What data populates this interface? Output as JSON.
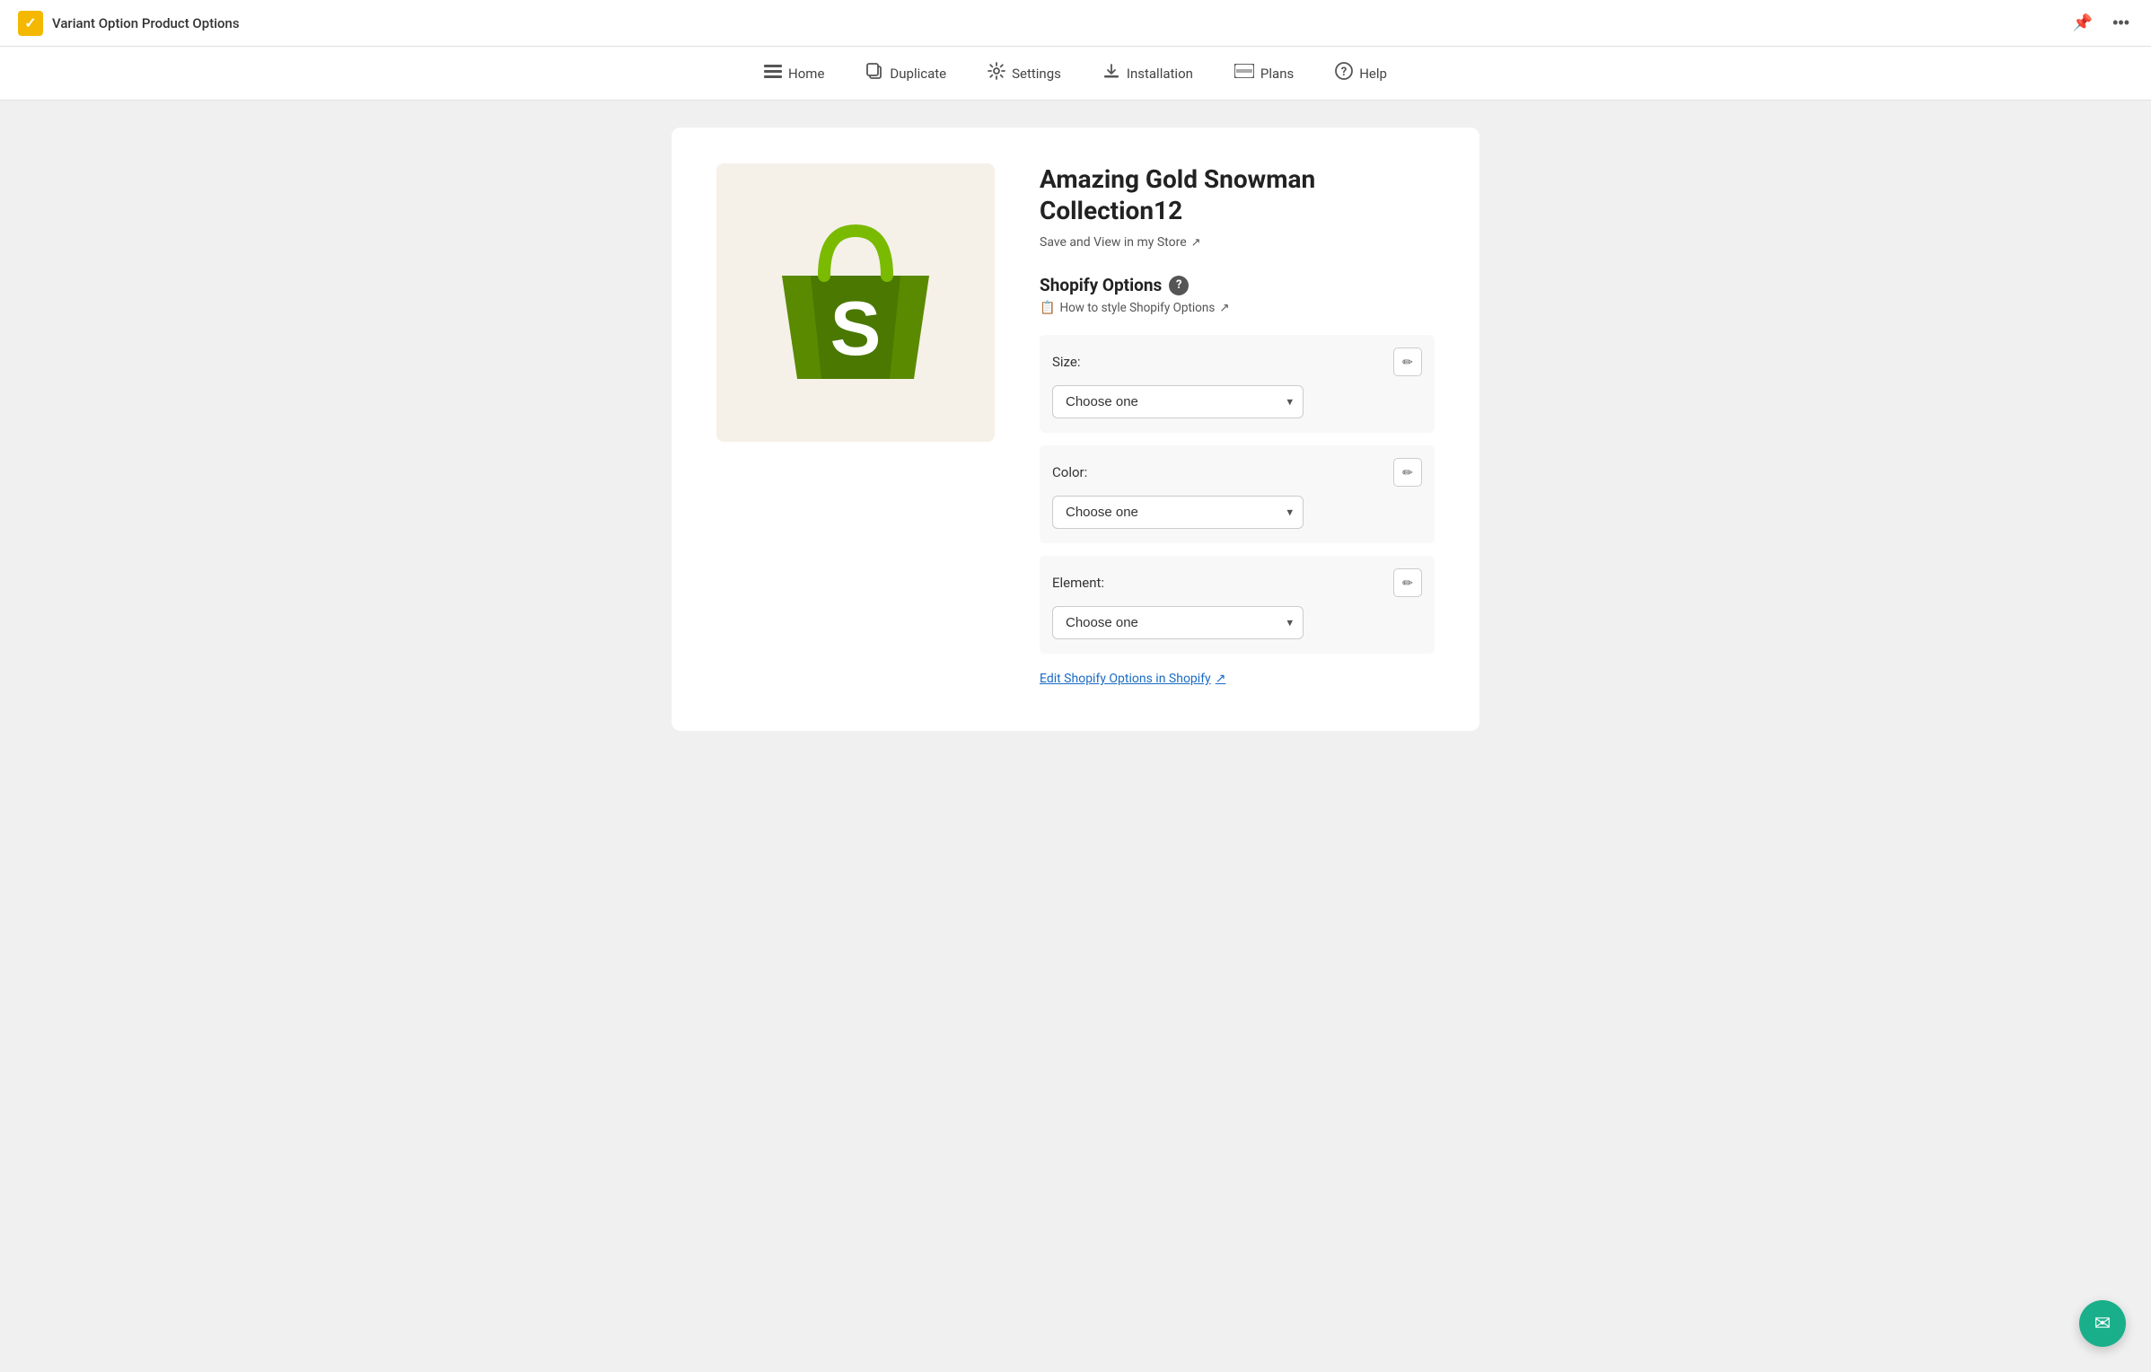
{
  "topbar": {
    "app_icon_char": "✓",
    "app_title": "Variant Option Product Options",
    "pin_icon": "📌",
    "more_icon": "···"
  },
  "nav": {
    "items": [
      {
        "id": "home",
        "icon": "≡",
        "label": "Home"
      },
      {
        "id": "duplicate",
        "icon": "⧉",
        "label": "Duplicate"
      },
      {
        "id": "settings",
        "icon": "🔧",
        "label": "Settings"
      },
      {
        "id": "installation",
        "icon": "⬇",
        "label": "Installation"
      },
      {
        "id": "plans",
        "icon": "▬",
        "label": "Plans"
      },
      {
        "id": "help",
        "icon": "?",
        "label": "Help"
      }
    ]
  },
  "product": {
    "title": "Amazing Gold Snowman Collection12",
    "save_view_link": "Save and View in my Store",
    "ext_icon": "↗"
  },
  "shopify_options": {
    "section_title": "Shopify Options",
    "style_link_icon": "📋",
    "style_link_text": "How to style Shopify Options",
    "edit_shopify_link": "Edit Shopify Options in Shopify",
    "options": [
      {
        "id": "size",
        "label": "Size:",
        "select_placeholder": "Choose one",
        "select_options": [
          "Choose one"
        ]
      },
      {
        "id": "color",
        "label": "Color:",
        "select_placeholder": "Choose one",
        "select_options": [
          "Choose one"
        ]
      },
      {
        "id": "element",
        "label": "Element:",
        "select_placeholder": "Choose one",
        "select_options": [
          "Choose one"
        ]
      }
    ]
  },
  "fab": {
    "icon": "✉"
  }
}
